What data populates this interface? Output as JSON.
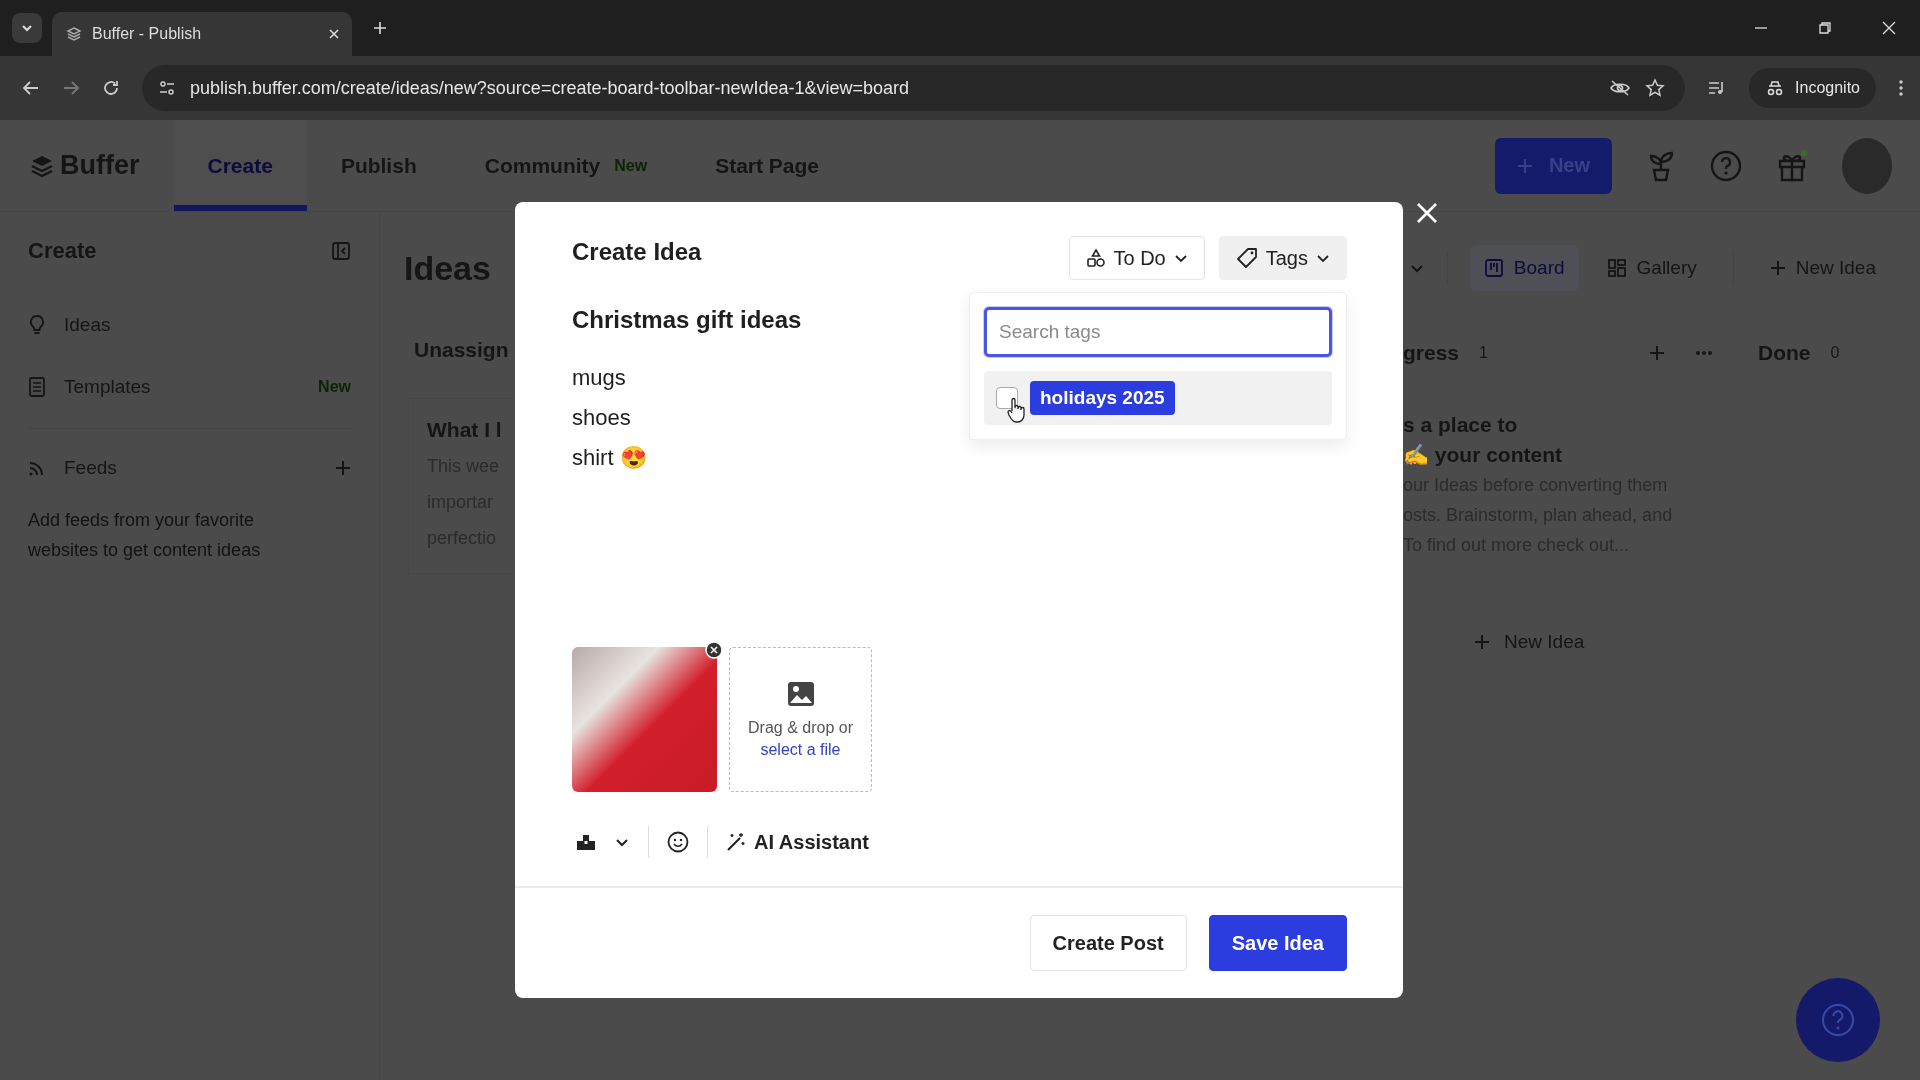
{
  "browser": {
    "tabs": [
      {
        "title": "Buffer - Publish",
        "selected": true
      }
    ],
    "url": "publish.buffer.com/create/ideas/new?source=create-board-toolbar-newIdea-1&view=board",
    "incognito": "Incognito"
  },
  "header": {
    "logo": "Buffer",
    "tabs": [
      {
        "label": "Create",
        "selected": true
      },
      {
        "label": "Publish",
        "selected": false
      },
      {
        "label": "Community",
        "badge": "New",
        "selected": false
      },
      {
        "label": "Start Page",
        "selected": false
      }
    ],
    "new_button": "New"
  },
  "sidebar": {
    "title": "Create",
    "items": [
      {
        "label": "Ideas"
      },
      {
        "label": "Templates",
        "badge": "New"
      }
    ],
    "feeds": {
      "label": "Feeds",
      "description": "Add feeds from your favorite websites to get content ideas"
    }
  },
  "board": {
    "title": "Ideas",
    "views": [
      {
        "label": "Board",
        "selected": true
      },
      {
        "label": "Gallery",
        "selected": false
      }
    ],
    "new_idea": "New Idea",
    "left_column": {
      "title": "Unassign",
      "card_title": "What I l",
      "card_lines": [
        "This wee",
        "importar",
        "perfectio"
      ]
    },
    "middle_column": {
      "title": "gress",
      "count": "1",
      "card_title_lines": [
        "s a place to",
        "✍ your content"
      ],
      "card_lines": [
        "our Ideas before converting them",
        "osts. Brainstorm, plan ahead, and",
        "To find out more check out..."
      ],
      "new_idea": "New Idea"
    },
    "done_column": {
      "title": "Done",
      "count": "0"
    }
  },
  "modal": {
    "title": "Create Idea",
    "status": "To Do",
    "tags_button": "Tags",
    "tag_search": {
      "placeholder": "Search tags"
    },
    "tag_options": [
      {
        "label": "holidays 2025",
        "checked": false
      }
    ],
    "idea_title": "Christmas gift ideas",
    "body_lines": [
      "mugs",
      "shoes",
      "shirt 😍"
    ],
    "dropzone": {
      "text": "Drag & drop or",
      "link": "select a file"
    },
    "ai_button": "AI Assistant",
    "buttons": [
      {
        "label": "Create Post",
        "kind": "secondary"
      },
      {
        "label": "Save Idea",
        "kind": "primary"
      }
    ]
  }
}
